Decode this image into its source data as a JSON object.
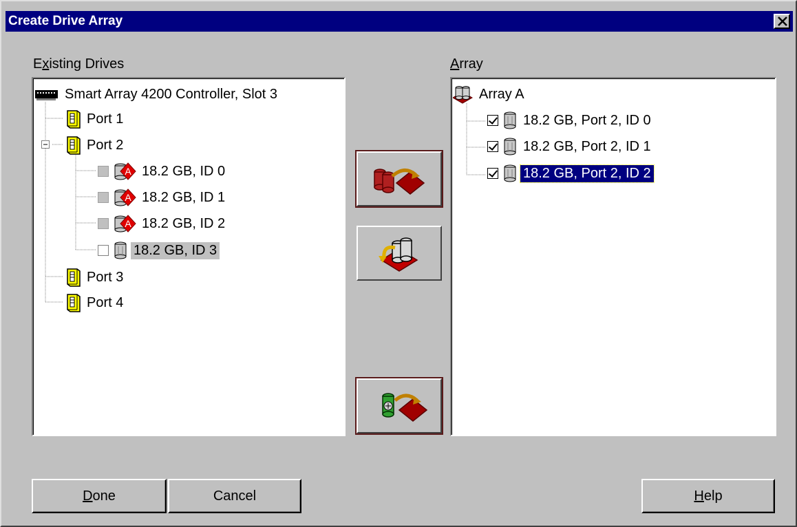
{
  "window": {
    "title": "Create Drive Array",
    "close_glyph": "✕"
  },
  "existing": {
    "label_prefix": "E",
    "label_accel": "x",
    "label_rest": "isting Drives",
    "controller": "Smart Array 4200 Controller, Slot 3",
    "ports": [
      {
        "label": "Port 1"
      },
      {
        "label": "Port 2"
      },
      {
        "label": "Port 3"
      },
      {
        "label": "Port 4"
      }
    ],
    "port2_drives": [
      {
        "label": "18.2 GB, ID 0",
        "state": "assigned"
      },
      {
        "label": "18.2 GB, ID 1",
        "state": "assigned"
      },
      {
        "label": "18.2 GB, ID 2",
        "state": "assigned"
      },
      {
        "label": "18.2 GB, ID 3",
        "state": "unassigned"
      }
    ]
  },
  "array": {
    "label_accel": "A",
    "label_rest": "rray",
    "root": "Array A",
    "drives": [
      {
        "label": "18.2 GB, Port 2, ID 0",
        "checked": true
      },
      {
        "label": "18.2 GB, Port 2, ID 1",
        "checked": true
      },
      {
        "label": "18.2 GB, Port 2, ID 2",
        "checked": true
      }
    ]
  },
  "buttons": {
    "done_accel": "D",
    "done_rest": "one",
    "cancel": "Cancel",
    "help_accel": "H",
    "help_rest": "elp"
  },
  "colors": {
    "face": "#c0c0c0",
    "title_bar": "#000080",
    "port_yellow": "#ffff00",
    "array_red": "#a00000"
  }
}
